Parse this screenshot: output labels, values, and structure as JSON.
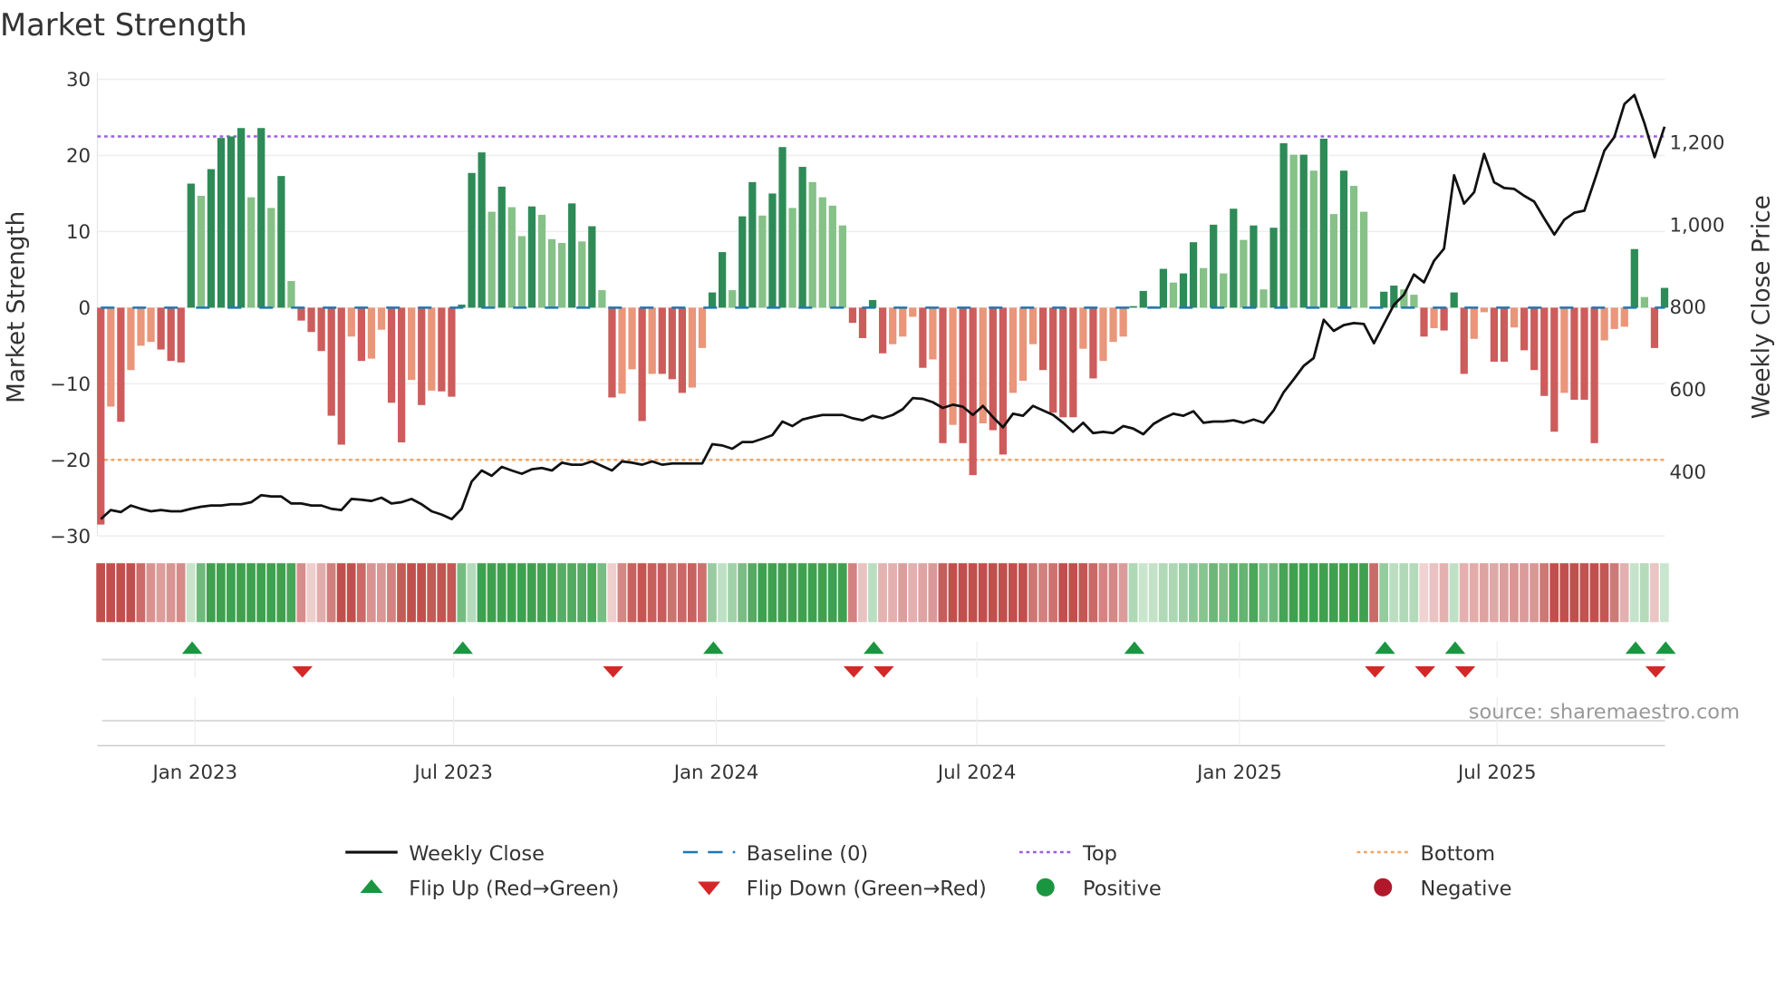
{
  "chart_data": {
    "type": "bar",
    "title": "Market Strength",
    "ylabel": "Market Strength",
    "y2label": "Weekly Close Price",
    "ylim": [
      -30,
      30
    ],
    "y2lim": [
      244,
      1353
    ],
    "yticks": [
      "30",
      "20",
      "10",
      "0",
      "−10",
      "−20",
      "−30"
    ],
    "ytick_values": [
      30,
      20,
      10,
      0,
      -10,
      -20,
      -30
    ],
    "y2ticks": [
      "1,200",
      "1,000",
      "800",
      "600",
      "400"
    ],
    "y2tick_values": [
      1200,
      1000,
      800,
      600,
      400
    ],
    "xticks": [
      "Jan 2023",
      "Jul 2023",
      "Jan 2024",
      "Jul 2024",
      "Jan 2025",
      "Jul 2025"
    ],
    "xtick_week_index": [
      9.4,
      35.2,
      61.4,
      87.4,
      113.6,
      139.3
    ],
    "top_level": 22.5,
    "bottom_level": -20,
    "grid": true,
    "source": "source: sharemaestro.com",
    "series": [
      {
        "name": "Market Strength",
        "values": [
          -28.5,
          -13,
          -15,
          -8.2,
          -5,
          -4.5,
          -5.5,
          -7,
          -7.2,
          16.3,
          14.7,
          18.2,
          22.3,
          22.5,
          23.6,
          14.5,
          23.6,
          13.1,
          17.3,
          3.5,
          -1.7,
          -3.2,
          -5.7,
          -14.2,
          -18,
          -3.8,
          -7,
          -6.7,
          -2.9,
          -12.5,
          -17.7,
          -9.5,
          -12.8,
          -10.9,
          -11,
          -11.7,
          0.4,
          17.7,
          20.4,
          12.6,
          15.9,
          13.2,
          9.4,
          13.3,
          12.2,
          9,
          8.5,
          13.7,
          8.7,
          10.7,
          2.3,
          -11.8,
          -11.3,
          -8.1,
          -14.9,
          -8.7,
          -8.7,
          -9.4,
          -11.2,
          -10.5,
          -5.3,
          2,
          7.3,
          2.3,
          12,
          16.5,
          12.1,
          15,
          21.1,
          13.1,
          18.5,
          16.5,
          14.5,
          13.4,
          10.8,
          -2,
          -4,
          1,
          -6,
          -4.8,
          -3.8,
          -1.2,
          -7.9,
          -6.8,
          -17.8,
          -15.4,
          -17.8,
          -22,
          -15.2,
          -16.1,
          -19.3,
          -11.2,
          -9.6,
          -4.8,
          -8.2,
          -13.8,
          -14.4,
          -14.4,
          -5.4,
          -9.3,
          -7,
          -4.5,
          -3.8,
          0.2,
          2.2,
          0.2,
          5.1,
          3.3,
          4.5,
          8.6,
          5.2,
          10.9,
          4.5,
          13,
          8.9,
          10.8,
          2.4,
          10.5,
          21.6,
          20.1,
          20.1,
          18,
          22.2,
          12.3,
          18,
          16,
          12.6,
          -0.1,
          2.1,
          2.9,
          2.4,
          1.7,
          -3.8,
          -2.7,
          -3,
          2,
          -8.7,
          -4.1,
          -0.6,
          -7.1,
          -7.1,
          -2.6,
          -5.6,
          -8.2,
          -11.6,
          -16.3,
          -11.2,
          -12.1,
          -12.1,
          -17.8,
          -4.3,
          -2.8,
          -2.5,
          7.7,
          1.4,
          -5.3,
          2.6
        ]
      },
      {
        "name": "Weekly Close",
        "values": [
          285,
          307,
          302,
          318,
          310,
          304,
          307,
          304,
          304,
          310,
          315,
          318,
          318,
          321,
          321,
          326,
          343,
          340,
          340,
          323,
          323,
          318,
          318,
          310,
          307,
          334,
          332,
          329,
          337,
          323,
          326,
          334,
          321,
          304,
          296,
          285,
          310,
          376,
          403,
          390,
          412,
          403,
          395,
          406,
          409,
          403,
          422,
          417,
          417,
          425,
          414,
          403,
          425,
          422,
          417,
          425,
          417,
          420,
          420,
          420,
          420,
          467,
          464,
          456,
          472,
          472,
          480,
          489,
          522,
          511,
          527,
          533,
          538,
          538,
          538,
          530,
          525,
          536,
          530,
          538,
          552,
          579,
          577,
          569,
          555,
          563,
          558,
          538,
          560,
          533,
          508,
          541,
          536,
          560,
          549,
          538,
          519,
          497,
          519,
          494,
          497,
          494,
          511,
          505,
          491,
          516,
          530,
          541,
          536,
          547,
          519,
          522,
          522,
          525,
          519,
          527,
          519,
          549,
          593,
          624,
          657,
          676,
          769,
          742,
          756,
          761,
          759,
          712,
          759,
          805,
          830,
          879,
          860,
          912,
          942,
          1120,
          1051,
          1079,
          1172,
          1103,
          1089,
          1087,
          1070,
          1056,
          1015,
          976,
          1012,
          1029,
          1034,
          1106,
          1180,
          1213,
          1293,
          1315,
          1246,
          1164,
          1238
        ]
      }
    ],
    "flip_up_week_index": [
      9,
      36,
      61,
      77,
      103,
      128,
      135,
      153,
      156
    ],
    "flip_down_week_index": [
      20,
      51,
      75,
      78,
      127,
      132,
      136,
      155
    ],
    "legend": {
      "placement": "bottom",
      "entries": [
        "Weekly Close",
        "Baseline (0)",
        "Top",
        "Bottom",
        "Flip Up (Red→Green)",
        "Flip Down (Green→Red)",
        "Positive",
        "Negative"
      ]
    },
    "colors": {
      "pos_strong": "#2e8b57",
      "pos_weak": "#86c187",
      "neg_strong": "#cd5c5c",
      "neg_weak": "#e9967a",
      "baseline": "#1f77b4",
      "top": "#9b5de5",
      "bottom": "#f4a460",
      "flip_up": "#1a9641",
      "flip_down": "#d62728",
      "positive": "#1a9641",
      "negative": "#b2182b",
      "line": "#111111"
    }
  }
}
